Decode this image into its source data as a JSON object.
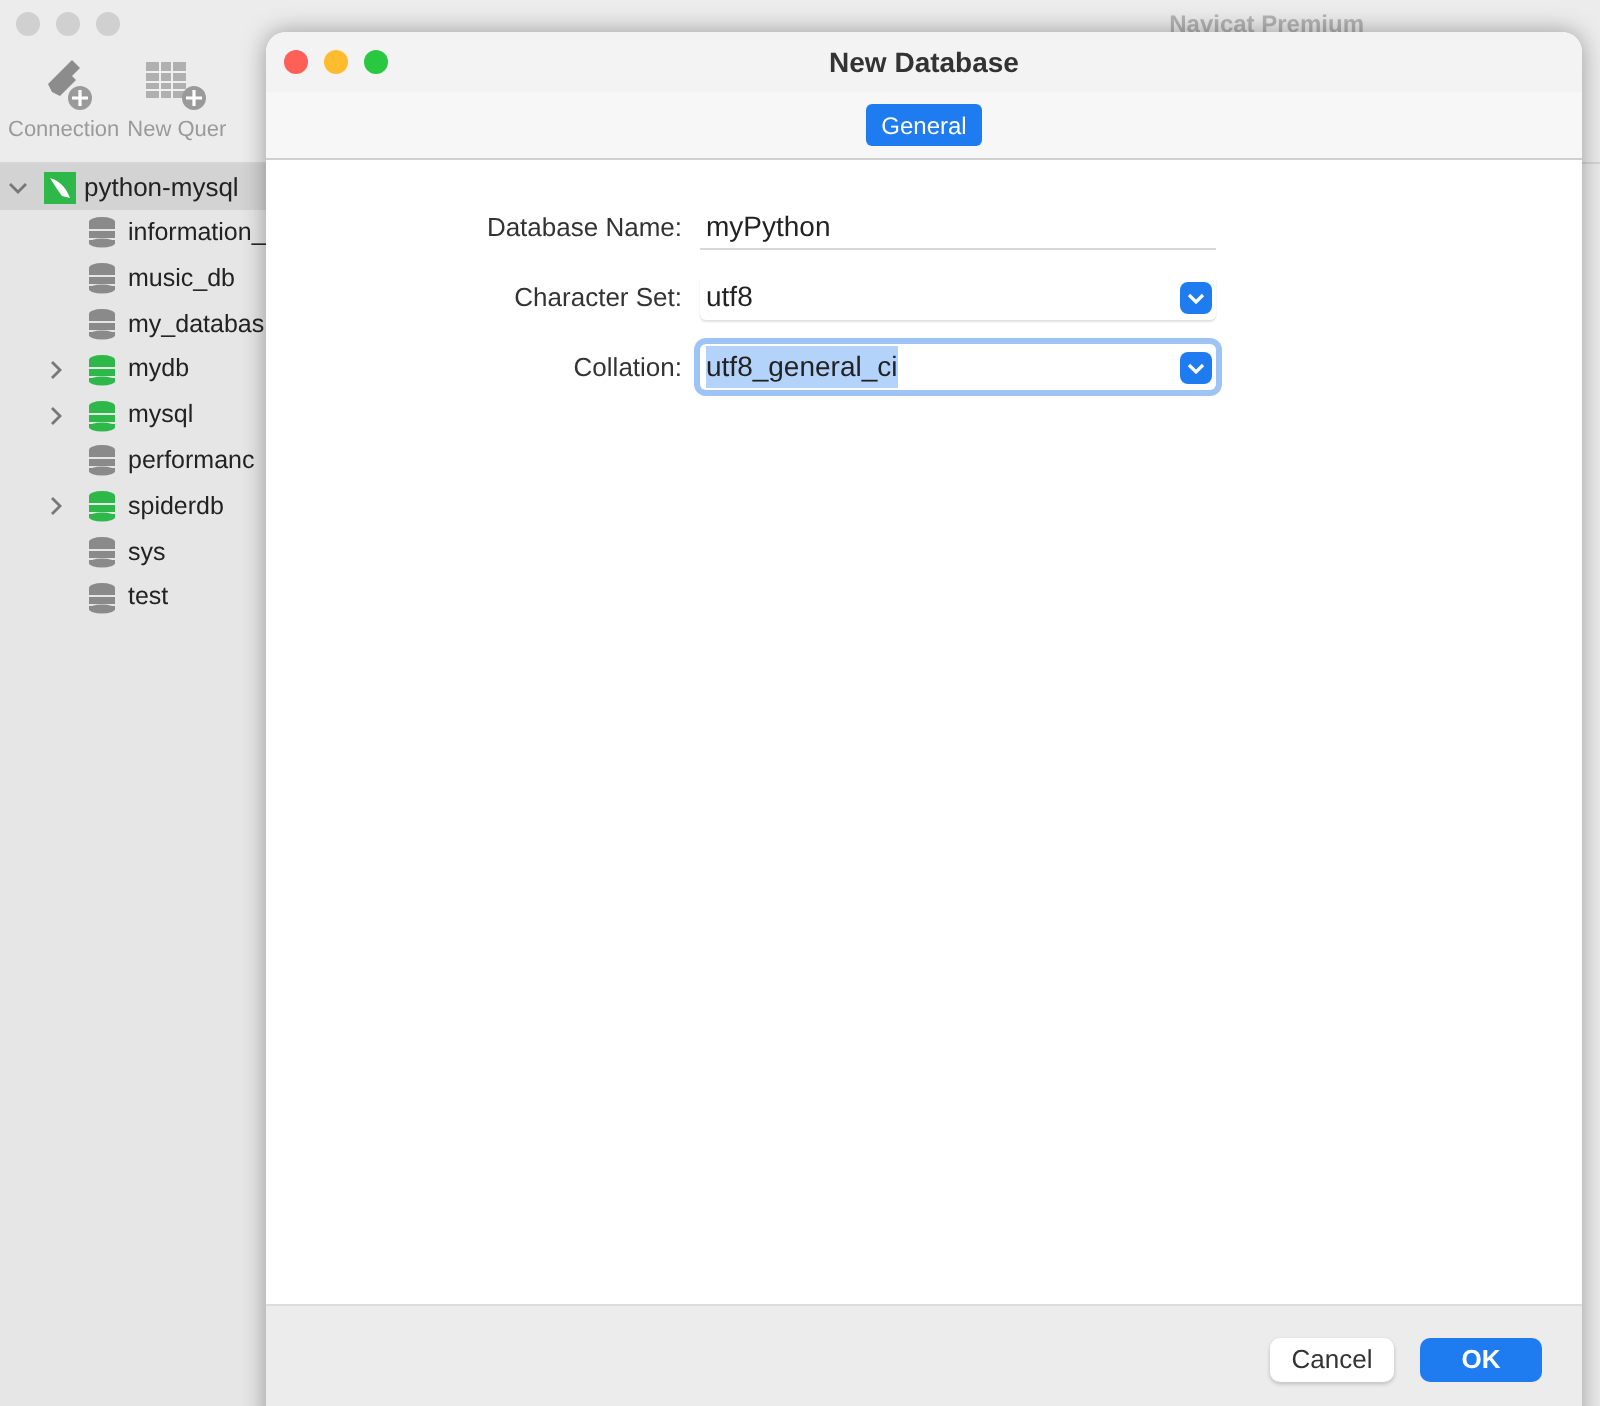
{
  "app": {
    "title": "Navicat Premium"
  },
  "toolbar": [
    {
      "label": "Connection",
      "kind": "connection"
    },
    {
      "label": "New Quer",
      "kind": "query"
    }
  ],
  "connection": {
    "name": "python-mysql",
    "expanded": true,
    "selected": true,
    "children": [
      {
        "name": "information_",
        "open": false,
        "expandable": false
      },
      {
        "name": "music_db",
        "open": false,
        "expandable": false
      },
      {
        "name": "my_databas",
        "open": false,
        "expandable": false
      },
      {
        "name": "mydb",
        "open": true,
        "expandable": true
      },
      {
        "name": "mysql",
        "open": true,
        "expandable": true
      },
      {
        "name": "performanc",
        "open": false,
        "expandable": false
      },
      {
        "name": "spiderdb",
        "open": true,
        "expandable": true
      },
      {
        "name": "sys",
        "open": false,
        "expandable": false
      },
      {
        "name": "test",
        "open": false,
        "expandable": false
      }
    ]
  },
  "dialog": {
    "title": "New Database",
    "tabs": [
      {
        "label": "General",
        "selected": true
      }
    ],
    "fields": [
      {
        "kind": "text",
        "label": "Database Name:",
        "value": "myPython",
        "focused": false
      },
      {
        "kind": "select",
        "label": "Character Set:",
        "value": "utf8",
        "focused": false
      },
      {
        "kind": "select",
        "label": "Collation:",
        "value": "utf8_general_ci",
        "focused": true
      }
    ],
    "buttons": [
      {
        "label": "Cancel",
        "primary": false
      },
      {
        "label": "OK",
        "primary": true
      }
    ]
  }
}
